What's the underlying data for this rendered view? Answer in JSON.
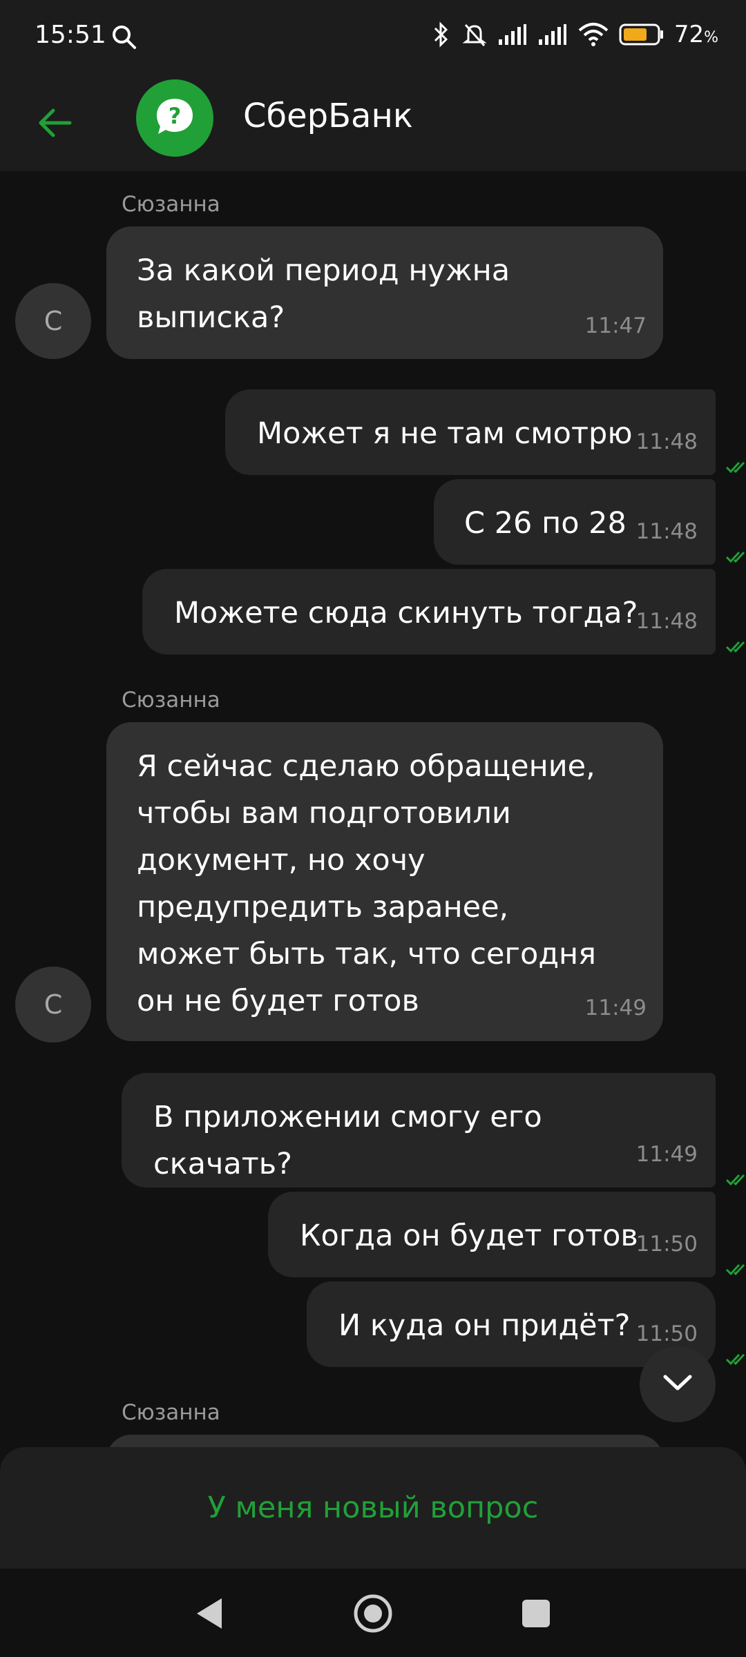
{
  "status_bar": {
    "time": "15:51",
    "battery_percent": "72",
    "battery_unit": "%",
    "battery_level": 0.72,
    "icons": [
      "search-icon",
      "bluetooth-icon",
      "mute-bell-icon",
      "signal-icon",
      "signal-icon",
      "wifi-icon",
      "battery-icon"
    ]
  },
  "header": {
    "title": "СберБанк",
    "back_icon": "arrow-left-icon",
    "avatar_icon": "question-chat-icon"
  },
  "colors": {
    "accent": "#21a038",
    "background": "#111111",
    "incoming_bubble": "#313131",
    "outgoing_bubble": "#262626"
  },
  "messages": [
    {
      "sender": "Сюзанна",
      "avatar_letter": "С",
      "text": "За какой период нужна выписка?",
      "time": "11:47",
      "direction": "in"
    },
    {
      "text": "Может я не там смотрю",
      "time": "11:48",
      "direction": "out",
      "status": "read"
    },
    {
      "text": "С 26 по 28",
      "time": "11:48",
      "direction": "out",
      "status": "read"
    },
    {
      "text": "Можете сюда скинуть тогда?",
      "time": "11:48",
      "direction": "out",
      "status": "read"
    },
    {
      "sender": "Сюзанна",
      "avatar_letter": "С",
      "text": "Я сейчас сделаю обращение, чтобы вам подготовили документ, но хочу предупредить заранее, может быть так, что сегодня он не будет готов",
      "time": "11:49",
      "direction": "in"
    },
    {
      "text": "В приложении смогу его скачать?",
      "time": "11:49",
      "direction": "out",
      "status": "read"
    },
    {
      "text": "Когда он будет готов",
      "time": "11:50",
      "direction": "out",
      "status": "read"
    },
    {
      "text": "И куда он придёт?",
      "time": "11:50",
      "direction": "out",
      "status": "read"
    },
    {
      "sender": "Сюзанна",
      "direction": "in",
      "text": "",
      "time": ""
    }
  ],
  "bottom": {
    "new_question_label": "У меня новый вопрос"
  },
  "nav": {
    "items": [
      "back-icon",
      "home-icon",
      "recents-icon"
    ]
  }
}
